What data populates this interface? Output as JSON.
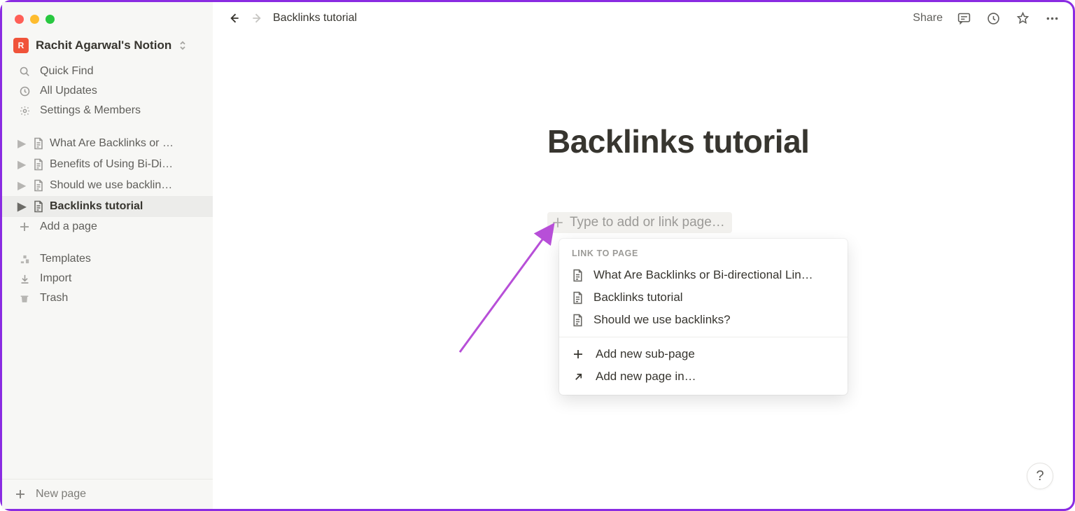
{
  "workspace": {
    "avatar_letter": "R",
    "name": "Rachit Agarwal's Notion"
  },
  "sidebar": {
    "quick_find": "Quick Find",
    "all_updates": "All Updates",
    "settings": "Settings & Members",
    "pages": [
      {
        "label": "What Are Backlinks or …"
      },
      {
        "label": "Benefits of Using Bi-Di…"
      },
      {
        "label": "Should we use backlin…"
      },
      {
        "label": "Backlinks tutorial"
      }
    ],
    "add_page": "Add a page",
    "templates": "Templates",
    "import": "Import",
    "trash": "Trash",
    "new_page": "New page"
  },
  "topbar": {
    "breadcrumb": "Backlinks tutorial",
    "share": "Share"
  },
  "page": {
    "title": "Backlinks tutorial",
    "add_placeholder": "Type to add or link page…"
  },
  "dropdown": {
    "header": "LINK TO PAGE",
    "items": [
      "What Are Backlinks or Bi-directional Lin…",
      "Backlinks tutorial",
      "Should we use backlinks?"
    ],
    "add_sub": "Add new sub-page",
    "add_in": "Add new page in…"
  },
  "help": "?"
}
